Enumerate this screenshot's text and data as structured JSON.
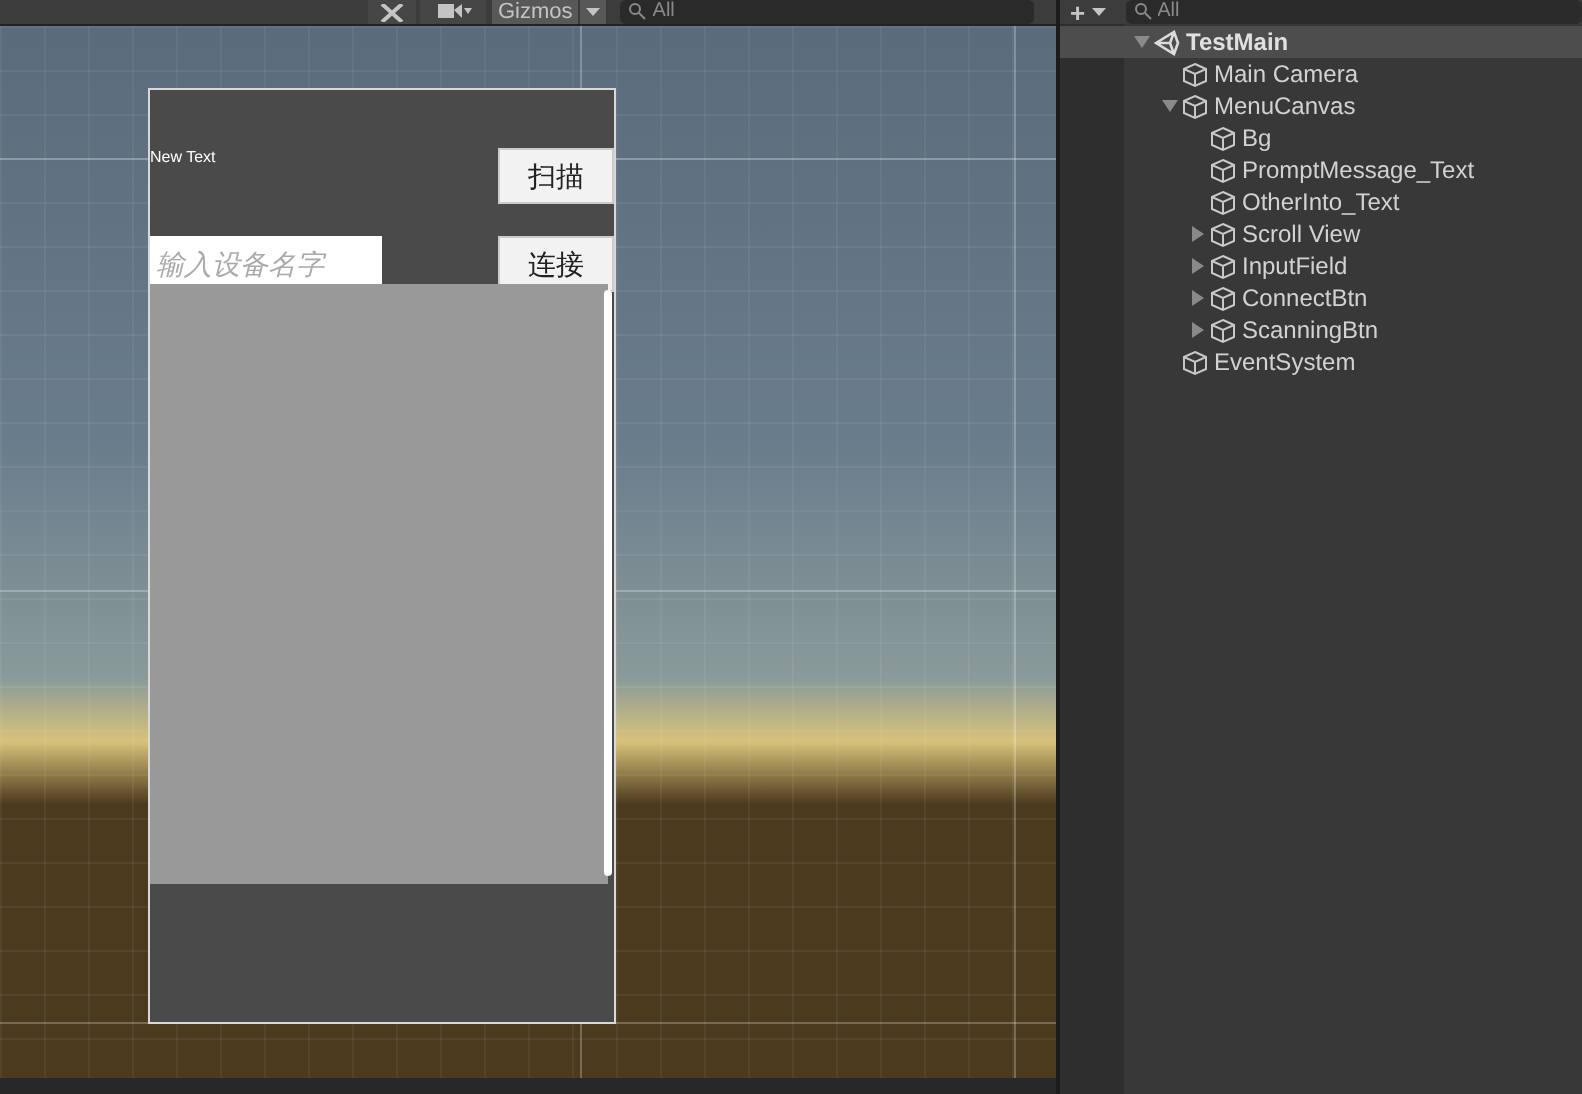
{
  "scene_toolbar": {
    "gizmos_label": "Gizmos",
    "search": {
      "placeholder": "All"
    }
  },
  "scene": {
    "new_text": "New Text",
    "scan_button": "扫描",
    "device_input": {
      "placeholder": "输入设备名字"
    },
    "connect_button": "连接"
  },
  "hierarchy_toolbar": {
    "add_label": "+",
    "search": {
      "placeholder": "All"
    }
  },
  "hierarchy": [
    {
      "label": "TestMain",
      "kind": "scene",
      "selected": true,
      "expanded": true,
      "children": [
        {
          "label": "Main Camera",
          "kind": "object",
          "selected": false
        },
        {
          "label": "MenuCanvas",
          "kind": "object",
          "selected": false,
          "expanded": true,
          "children": [
            {
              "label": "Bg",
              "kind": "object",
              "selected": false
            },
            {
              "label": "PromptMessage_Text",
              "kind": "object",
              "selected": false
            },
            {
              "label": "OtherInto_Text",
              "kind": "object",
              "selected": false
            },
            {
              "label": "Scroll View",
              "kind": "object",
              "selected": false,
              "expanded": false
            },
            {
              "label": "InputField",
              "kind": "object",
              "selected": false,
              "expanded": false
            },
            {
              "label": "ConnectBtn",
              "kind": "object",
              "selected": false,
              "expanded": false
            },
            {
              "label": "ScanningBtn",
              "kind": "object",
              "selected": false,
              "expanded": false
            }
          ]
        },
        {
          "label": "EventSystem",
          "kind": "object",
          "selected": false
        }
      ]
    }
  ]
}
